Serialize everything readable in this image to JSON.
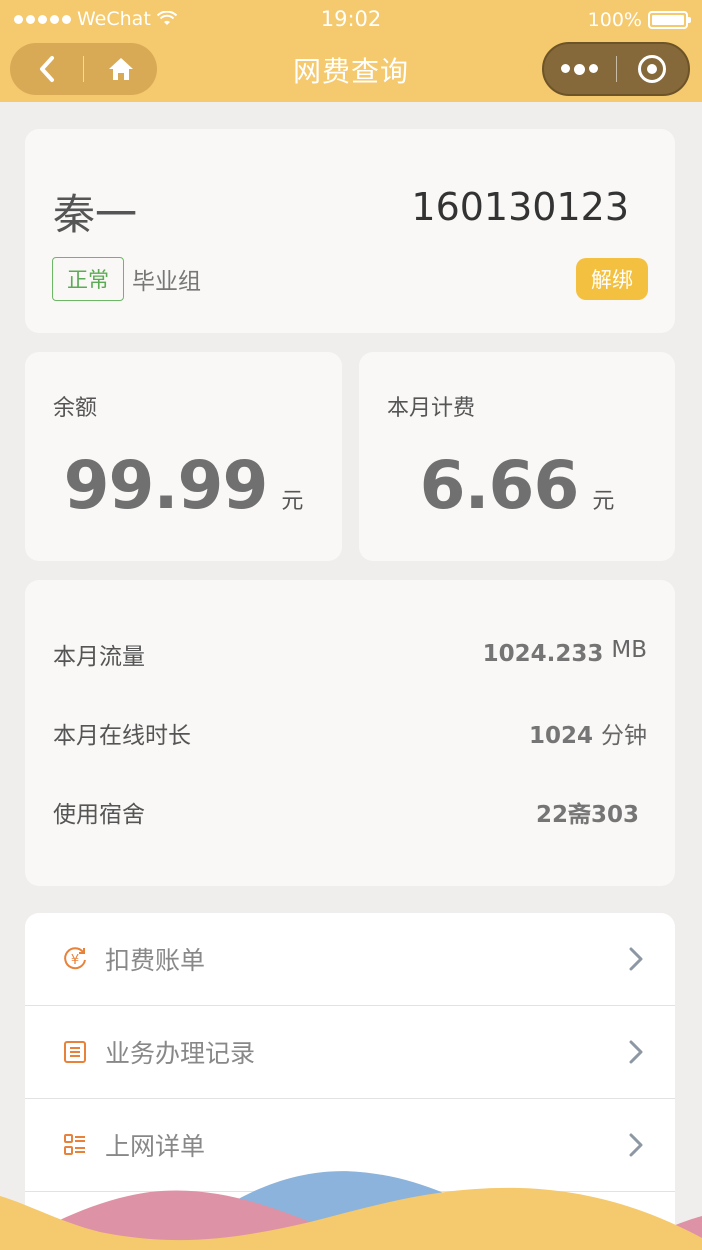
{
  "status_bar": {
    "carrier": "WeChat",
    "time": "19:02",
    "battery": "100%"
  },
  "nav": {
    "title": "网费查询"
  },
  "user": {
    "name": "秦一",
    "student_id": "160130123",
    "status": "正常",
    "group": "毕业组",
    "unbind_label": "解绑"
  },
  "balance": {
    "label": "余额",
    "value": "99.99",
    "unit": "元"
  },
  "monthly_fee": {
    "label": "本月计费",
    "value": "6.66",
    "unit": "元"
  },
  "usage": {
    "traffic_label": "本月流量",
    "traffic_value": "1024.233",
    "traffic_unit": "MB",
    "online_label": "本月在线时长",
    "online_value": "1024",
    "online_unit": "分钟",
    "dorm_label": "使用宿舍",
    "dorm_value": "22斋303"
  },
  "menu": {
    "items": [
      {
        "label": "扣费账单",
        "icon": "yuan-refresh-icon"
      },
      {
        "label": "业务办理记录",
        "icon": "record-icon"
      },
      {
        "label": "上网详单",
        "icon": "list-detail-icon"
      }
    ]
  },
  "colors": {
    "theme": "#f5c96e",
    "accent": "#e8813a",
    "badge_green": "#5aab53",
    "unbind": "#f4c040"
  }
}
